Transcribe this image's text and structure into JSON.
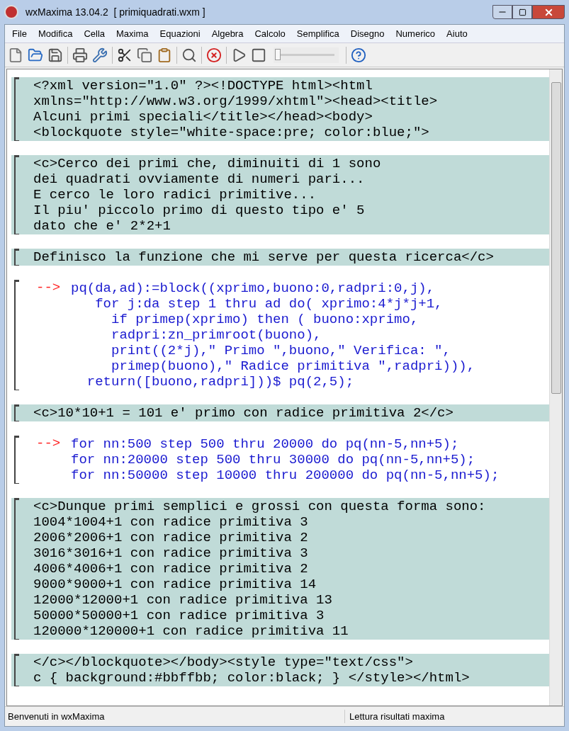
{
  "window": {
    "title": "wxMaxima 13.04.2  [ primiquadrati.wxm ]"
  },
  "menu": [
    "File",
    "Modifica",
    "Cella",
    "Maxima",
    "Equazioni",
    "Algebra",
    "Calcolo",
    "Semplifica",
    "Disegno",
    "Numerico",
    "Aiuto"
  ],
  "toolbar": {
    "animation_slider": {
      "level": 0
    }
  },
  "cells": [
    {
      "kind": "text",
      "lines": [
        "<?xml version=\"1.0\" ?><!DOCTYPE html><html",
        "xmlns=\"http://www.w3.org/1999/xhtml\"><head><title>",
        "Alcuni primi speciali</title></head><body>",
        "<blockquote style=\"white-space:pre; color:blue;\">"
      ]
    },
    {
      "kind": "text",
      "lines": [
        "<c>Cerco dei primi che, diminuiti di 1 sono",
        "dei quadrati ovviamente di numeri pari...",
        "E cerco le loro radici primitive...",
        "Il piu' piccolo primo di questo tipo e' 5",
        "dato che e' 2*2+1"
      ]
    },
    {
      "kind": "text",
      "lines": [
        "Definisco la funzione che mi serve per questa ricerca</c>"
      ]
    },
    {
      "kind": "input",
      "prompt": "-->",
      "lines": [
        "pq(da,ad):=block((xprimo,buono:0,radpri:0,j),",
        "   for j:da step 1 thru ad do( xprimo:4*j*j+1,",
        "     if primep(xprimo) then ( buono:xprimo,",
        "     radpri:zn_primroot(buono),",
        "     print((2*j),\" Primo \",buono,\" Verifica: \",",
        "     primep(buono),\" Radice primitiva \",radpri))),",
        "  return([buono,radpri]))$ pq(2,5);"
      ]
    },
    {
      "kind": "text",
      "lines": [
        "<c>10*10+1 = 101 e' primo con radice primitiva 2</c>"
      ]
    },
    {
      "kind": "input",
      "prompt": "-->",
      "lines": [
        "for nn:500 step 500 thru 20000 do pq(nn-5,nn+5);",
        "for nn:20000 step 500 thru 30000 do pq(nn-5,nn+5);",
        "for nn:50000 step 10000 thru 200000 do pq(nn-5,nn+5);"
      ]
    },
    {
      "kind": "text",
      "lines": [
        "<c>Dunque primi semplici e grossi con questa forma sono:",
        "1004*1004+1 con radice primitiva 3",
        "2006*2006+1 con radice primitiva 2",
        "3016*3016+1 con radice primitiva 3",
        "4006*4006+1 con radice primitiva 2",
        "9000*9000+1 con radice primitiva 14",
        "12000*12000+1 con radice primitiva 13",
        "50000*50000+1 con radice primitiva 3",
        "120000*120000+1 con radice primitiva 11"
      ]
    },
    {
      "kind": "text",
      "lines": [
        "</c></blockquote></body><style type=\"text/css\">",
        "c { background:#bbffbb; color:black; } </style></html>"
      ]
    }
  ],
  "status_bar": [
    "Benvenuti in wxMaxima",
    "Lettura risultati maxima"
  ]
}
